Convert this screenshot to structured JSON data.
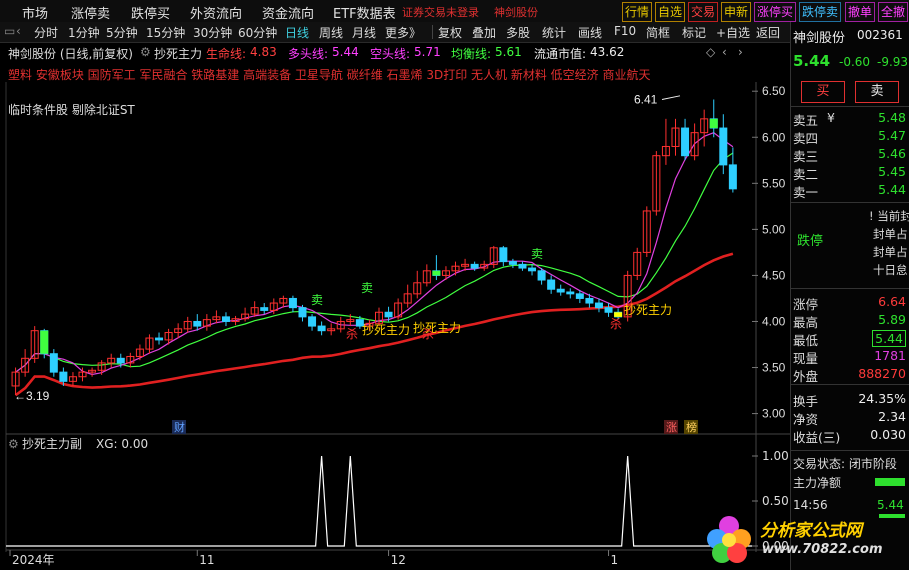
{
  "menu": {
    "items": [
      "市场",
      "涨停卖",
      "跌停买",
      "外资流向",
      "资金流向",
      "ETF数据表"
    ],
    "login_status": "证券交易未登录",
    "stock_tag": "神剑股份"
  },
  "right_buttons": [
    "行情",
    "自选",
    "交易",
    "申新",
    "涨停买",
    "跌停卖",
    "撤单",
    "全撤"
  ],
  "toolbar": {
    "items": [
      "分时",
      "1分钟",
      "5分钟",
      "15分钟",
      "30分钟",
      "60分钟",
      "日线",
      "周线",
      "月线",
      "更多》",
      "复权",
      "叠加",
      "多股",
      "统计",
      "画线",
      "F10",
      "简框",
      "标记",
      "+自选",
      "返回"
    ],
    "active": "日线"
  },
  "info": {
    "title": "神剑股份 (日线,前复权)",
    "indicator": "抄死主力",
    "lifeline_label": "生命线:",
    "lifeline_value": "4.83",
    "bull_label": "多头线:",
    "bull_value": "5.44",
    "bear_label": "空头线:",
    "bear_value": "5.71",
    "avg_label": "均衡线:",
    "avg_value": "5.61",
    "mktcap_label": "流通市值:",
    "mktcap_value": "43.62"
  },
  "concepts": "塑料 安徽板块 国防军工 军民融合 铁路基建 高端装备 卫星导航 碳纤维 石墨烯 3D打印 无人机 新材料 低空经济 商业航天",
  "condition_text": "临时条件股 剔除北证ST",
  "chart_data": {
    "type": "candlestick",
    "x_ticks": [
      "2024年",
      "11",
      "12",
      "1"
    ],
    "y_ticks": [
      "6.50",
      "6.00",
      "5.50",
      "5.00",
      "4.50",
      "4.00",
      "3.50",
      "3.00"
    ],
    "ylim": [
      2.8,
      6.6
    ],
    "high_label": "6.41",
    "low_label": "3.19",
    "annotations": [
      "卖",
      "卖",
      "卖",
      "抄死主力",
      "抄死主力",
      "抄死主力",
      "杀",
      "杀",
      "杀"
    ],
    "markers": [
      "财",
      "涨",
      "榜"
    ],
    "candles": [
      [
        3.3,
        3.45,
        3.2,
        3.5
      ],
      [
        3.45,
        3.6,
        3.4,
        3.7
      ],
      [
        3.6,
        3.9,
        3.55,
        3.95
      ],
      [
        3.9,
        3.65,
        3.6,
        3.92
      ],
      [
        3.65,
        3.45,
        3.4,
        3.7
      ],
      [
        3.45,
        3.35,
        3.3,
        3.5
      ],
      [
        3.35,
        3.4,
        3.3,
        3.45
      ],
      [
        3.4,
        3.45,
        3.35,
        3.5
      ],
      [
        3.45,
        3.47,
        3.4,
        3.5
      ],
      [
        3.47,
        3.55,
        3.42,
        3.58
      ],
      [
        3.55,
        3.6,
        3.5,
        3.65
      ],
      [
        3.6,
        3.55,
        3.5,
        3.65
      ],
      [
        3.55,
        3.62,
        3.5,
        3.66
      ],
      [
        3.62,
        3.7,
        3.58,
        3.75
      ],
      [
        3.7,
        3.82,
        3.65,
        3.86
      ],
      [
        3.82,
        3.8,
        3.75,
        3.88
      ],
      [
        3.8,
        3.88,
        3.75,
        3.92
      ],
      [
        3.88,
        3.92,
        3.82,
        3.98
      ],
      [
        3.92,
        4.0,
        3.88,
        4.05
      ],
      [
        4.0,
        3.95,
        3.9,
        4.08
      ],
      [
        3.95,
        4.02,
        3.9,
        4.08
      ],
      [
        4.02,
        4.05,
        3.98,
        4.12
      ],
      [
        4.05,
        4.0,
        3.95,
        4.1
      ],
      [
        4.0,
        4.03,
        3.96,
        4.06
      ],
      [
        4.03,
        4.08,
        4.0,
        4.15
      ],
      [
        4.08,
        4.15,
        4.05,
        4.22
      ],
      [
        4.15,
        4.12,
        4.08,
        4.2
      ],
      [
        4.12,
        4.2,
        4.08,
        4.25
      ],
      [
        4.2,
        4.25,
        4.15,
        4.28
      ],
      [
        4.25,
        4.15,
        4.1,
        4.28
      ],
      [
        4.15,
        4.05,
        4.0,
        4.18
      ],
      [
        4.05,
        3.95,
        3.9,
        4.08
      ],
      [
        3.95,
        3.9,
        3.85,
        4.0
      ],
      [
        3.9,
        3.92,
        3.85,
        3.98
      ],
      [
        3.92,
        4.0,
        3.88,
        4.05
      ],
      [
        4.0,
        4.02,
        3.95,
        4.08
      ],
      [
        4.02,
        3.95,
        3.92,
        4.06
      ],
      [
        3.95,
        3.98,
        3.9,
        4.02
      ],
      [
        3.98,
        4.1,
        3.95,
        4.15
      ],
      [
        4.1,
        4.05,
        4.0,
        4.16
      ],
      [
        4.05,
        4.2,
        4.02,
        4.25
      ],
      [
        4.2,
        4.3,
        4.15,
        4.4
      ],
      [
        4.3,
        4.42,
        4.25,
        4.55
      ],
      [
        4.42,
        4.55,
        4.38,
        4.62
      ],
      [
        4.55,
        4.5,
        4.45,
        4.72
      ],
      [
        4.5,
        4.55,
        4.45,
        4.6
      ],
      [
        4.55,
        4.6,
        4.5,
        4.65
      ],
      [
        4.6,
        4.62,
        4.55,
        4.68
      ],
      [
        4.62,
        4.58,
        4.55,
        4.65
      ],
      [
        4.58,
        4.62,
        4.55,
        4.66
      ],
      [
        4.62,
        4.8,
        4.58,
        4.82
      ],
      [
        4.8,
        4.65,
        4.6,
        4.82
      ],
      [
        4.65,
        4.62,
        4.58,
        4.68
      ],
      [
        4.62,
        4.58,
        4.55,
        4.65
      ],
      [
        4.58,
        4.55,
        4.5,
        4.62
      ],
      [
        4.55,
        4.45,
        4.4,
        4.58
      ],
      [
        4.45,
        4.35,
        4.3,
        4.5
      ],
      [
        4.35,
        4.32,
        4.28,
        4.4
      ],
      [
        4.32,
        4.3,
        4.25,
        4.36
      ],
      [
        4.3,
        4.25,
        4.2,
        4.34
      ],
      [
        4.25,
        4.2,
        4.15,
        4.3
      ],
      [
        4.2,
        4.15,
        4.1,
        4.25
      ],
      [
        4.15,
        4.1,
        4.05,
        4.2
      ],
      [
        4.1,
        4.05,
        4.02,
        4.14
      ],
      [
        4.05,
        4.5,
        4.0,
        4.55
      ],
      [
        4.5,
        4.75,
        4.45,
        4.8
      ],
      [
        4.75,
        5.2,
        4.7,
        5.25
      ],
      [
        5.2,
        5.8,
        5.15,
        5.85
      ],
      [
        5.8,
        5.9,
        5.7,
        6.2
      ],
      [
        5.9,
        6.1,
        5.8,
        6.2
      ],
      [
        6.1,
        5.8,
        5.75,
        6.2
      ],
      [
        5.8,
        6.05,
        5.75,
        6.15
      ],
      [
        6.05,
        6.2,
        5.9,
        6.3
      ],
      [
        6.2,
        6.1,
        6.0,
        6.41
      ],
      [
        6.1,
        5.7,
        5.6,
        6.25
      ],
      [
        5.7,
        5.44,
        5.4,
        5.89
      ]
    ],
    "sub_indicator": {
      "title": "抄死主力副",
      "xg_label": "XG: 0.00",
      "y_ticks": [
        "1.00",
        "0.50",
        "0.00"
      ],
      "spikes": [
        0,
        0,
        0,
        0,
        0,
        0,
        0,
        0,
        0,
        0,
        0,
        0,
        0,
        0,
        0,
        0,
        0,
        0,
        0,
        0,
        0,
        0,
        0,
        0,
        0,
        0,
        0,
        0,
        0,
        0,
        0,
        0,
        1,
        0,
        0,
        1,
        0,
        0,
        0,
        0,
        0,
        0,
        0,
        0,
        0,
        0,
        0,
        0,
        0,
        0,
        0,
        0,
        0,
        0,
        0,
        0,
        0,
        0,
        0,
        0,
        0,
        0,
        0,
        0,
        1,
        0,
        0,
        0,
        0,
        0,
        0,
        0,
        0,
        0,
        0
      ]
    }
  },
  "quote": {
    "name": "神剑股份",
    "code": "002361",
    "price": "5.44",
    "change": "-0.60",
    "pct": "-9.93",
    "buy_btn": "买",
    "sell_btn": "卖",
    "asks": [
      {
        "label": "卖五",
        "price": "5.48",
        "extra": "¥"
      },
      {
        "label": "卖四",
        "price": "5.47",
        "extra": ""
      },
      {
        "label": "卖三",
        "price": "5.46",
        "extra": ""
      },
      {
        "label": "卖二",
        "price": "5.45",
        "extra": ""
      },
      {
        "label": "卖一",
        "price": "5.44",
        "extra": ""
      }
    ],
    "limit_down": "跌停",
    "notes": [
      "! 当前封",
      "封单占",
      "封单占",
      "十日怠"
    ],
    "stats": [
      {
        "label": "涨停",
        "value": "6.64",
        "color": "red"
      },
      {
        "label": "最高",
        "value": "5.89",
        "color": "green"
      },
      {
        "label": "最低",
        "value": "5.44",
        "color": "green"
      },
      {
        "label": "现量",
        "value": "1781",
        "color": "mag"
      },
      {
        "label": "外盘",
        "value": "888270",
        "color": "red"
      }
    ],
    "stats2": [
      {
        "label": "换手",
        "value": "24.35%",
        "color": "white"
      },
      {
        "label": "净资",
        "value": "2.34",
        "color": "white"
      },
      {
        "label": "收益(三)",
        "value": "0.030",
        "color": "white"
      }
    ],
    "trade_state": "交易状态: 闭市阶段",
    "main_net": "主力净额",
    "time": "14:56",
    "time_price": "5.44",
    "watermark": "分析家公式网",
    "watermark_url": "www.70822.com"
  }
}
